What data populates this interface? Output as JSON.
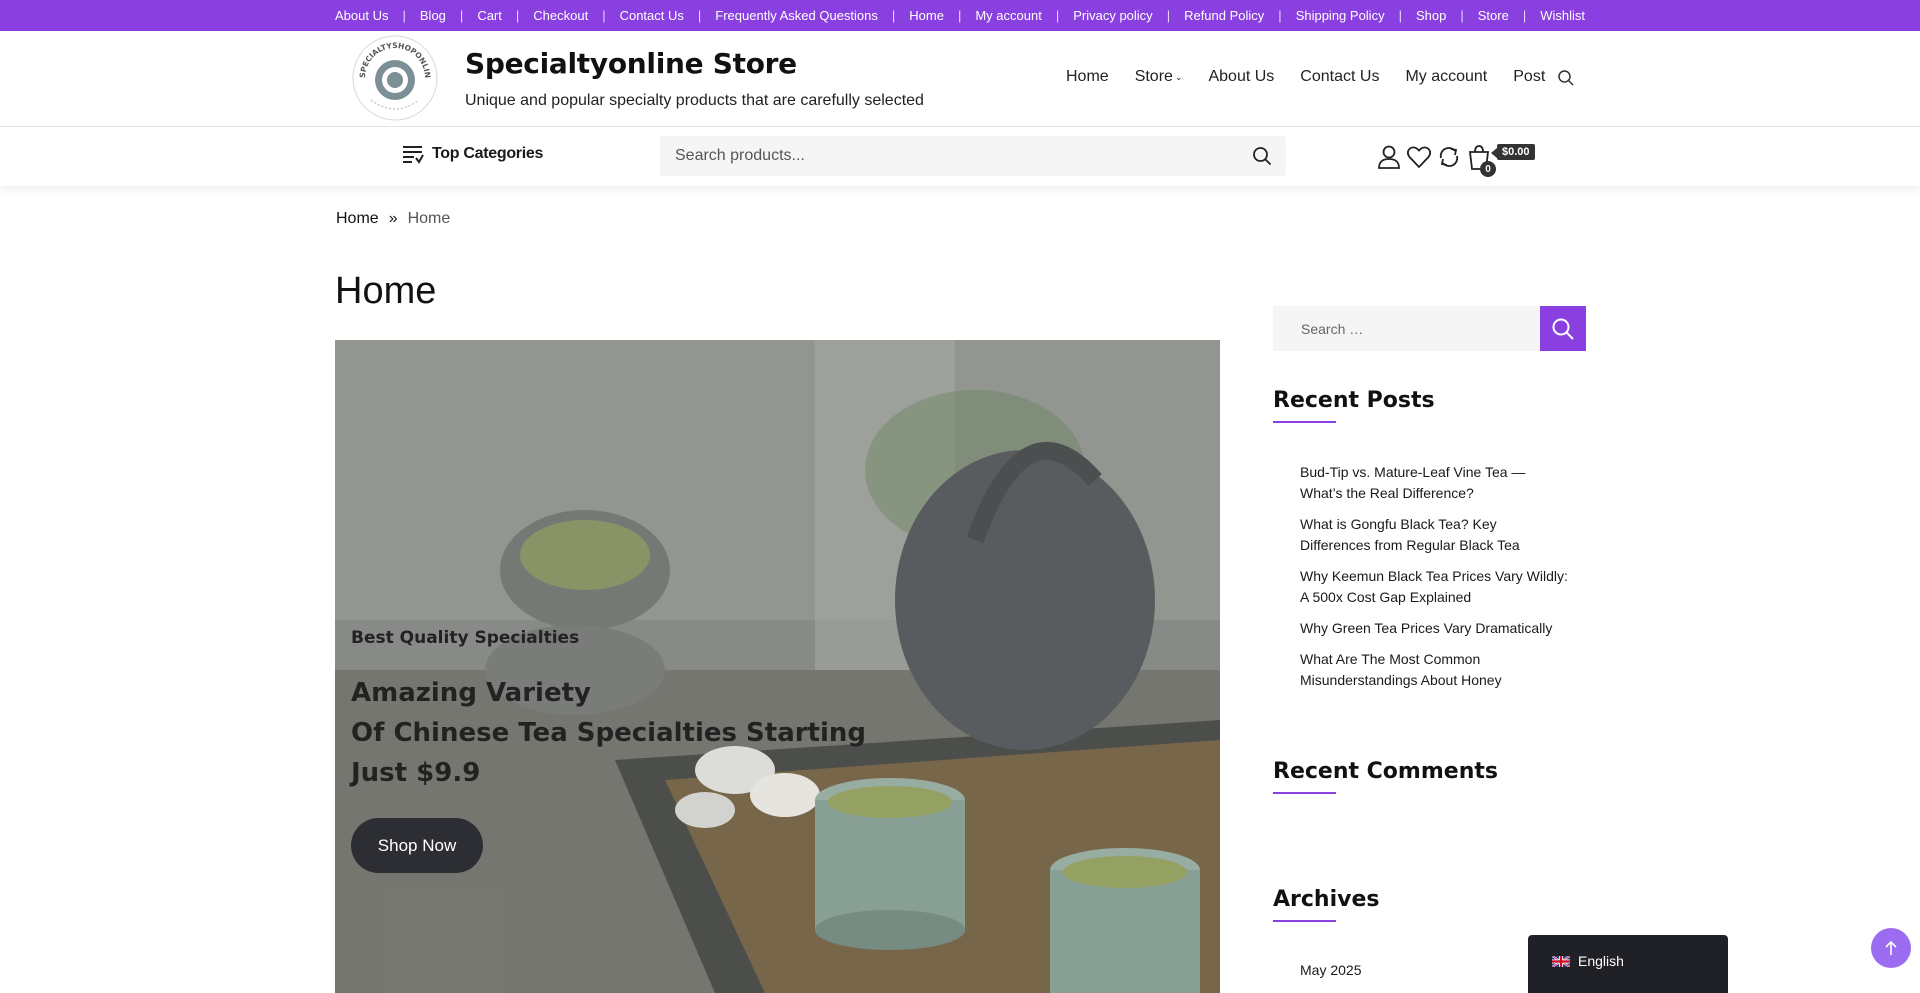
{
  "topbar": {
    "links": [
      "About Us",
      "Blog",
      "Cart",
      "Checkout",
      "Contact Us",
      "Frequently Asked Questions",
      "Home",
      "My account",
      "Privacy policy",
      "Refund Policy",
      "Shipping Policy",
      "Shop",
      "Store",
      "Wishlist"
    ],
    "separator": "|"
  },
  "header": {
    "logo_text": "SPECIALTYSHOPONLINE",
    "title": "Specialtyonline Store",
    "tagline": "Unique and popular specialty products that are carefully selected",
    "nav": {
      "home": "Home",
      "store": "Store",
      "about": "About Us",
      "contact": "Contact Us",
      "account": "My account",
      "post": "Post"
    },
    "caret": "⌄"
  },
  "subbar": {
    "categories_label": "Top Categories",
    "search_placeholder": "Search products...",
    "cart_count": "0",
    "cart_total": "$0.00"
  },
  "breadcrumb": {
    "home": "Home",
    "separator": "»",
    "current": "Home"
  },
  "page": {
    "title": "Home"
  },
  "hero": {
    "subtitle": "Best Quality Specialties",
    "headline_1": "Amazing Variety",
    "headline_2": "Of Chinese Tea Specialties Starting",
    "headline_3": "Just $9.9",
    "button": "Shop Now"
  },
  "sidebar": {
    "search_placeholder": "Search …",
    "recent_posts_title": "Recent Posts",
    "recent_posts": [
      "Bud-Tip vs. Mature-Leaf Vine Tea — What’s the Real Difference?",
      "What is Gongfu Black Tea? Key Differences from Regular Black Tea",
      "Why Keemun Black Tea Prices Vary Wildly: A 500x Cost Gap Explained",
      "Why Green Tea Prices Vary Dramatically",
      "What Are The Most Common Misunderstandings About Honey"
    ],
    "recent_comments_title": "Recent Comments",
    "archives_title": "Archives",
    "archives": [
      "May 2025"
    ]
  },
  "language": {
    "label": "English"
  },
  "colors": {
    "accent": "#8a3fe0",
    "dark": "#2c2e33",
    "scroll_top": "#9b6cf0"
  },
  "icons": [
    "list-icon",
    "search-icon",
    "user-icon",
    "heart-icon",
    "compare-icon",
    "cart-icon",
    "arrow-up-icon",
    "uk-flag-icon"
  ]
}
